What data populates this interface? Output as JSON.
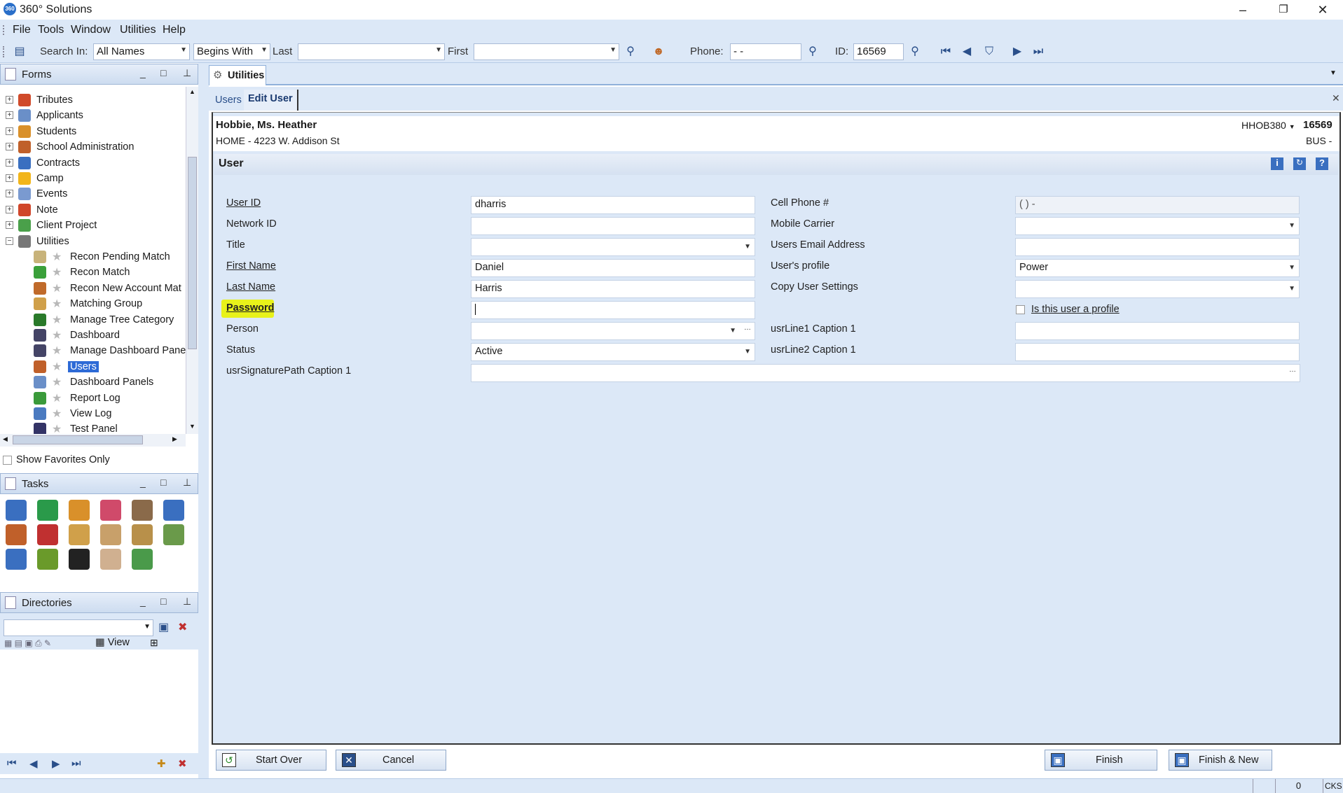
{
  "app": {
    "title": "360° Solutions",
    "logo_text": "360"
  },
  "window_controls": {
    "minimize": "–",
    "restore": "❐",
    "close": "✕"
  },
  "menu": [
    "File",
    "Tools",
    "Window",
    "Utilities",
    "Help"
  ],
  "toolbar": {
    "search_in_label": "Search In:",
    "search_in_value": "All Names",
    "match_value": "Begins With",
    "last_label": "Last",
    "last_value": "",
    "first_label": "First",
    "first_value": "",
    "phone_label": "Phone:",
    "phone_value": "-  -",
    "id_label": "ID:",
    "id_value": "16569"
  },
  "forms_pane": {
    "title": "Forms",
    "tree": [
      {
        "label": "Tributes",
        "level": 0,
        "color": "#d04a2a"
      },
      {
        "label": "Applicants",
        "level": 0,
        "color": "#6a8fc8"
      },
      {
        "label": "Students",
        "level": 0,
        "color": "#d9902a"
      },
      {
        "label": "School Administration",
        "level": 0,
        "color": "#c0602a"
      },
      {
        "label": "Contracts",
        "level": 0,
        "color": "#3a6fc0"
      },
      {
        "label": "Camp",
        "level": 0,
        "color": "#f2b51a"
      },
      {
        "label": "Events",
        "level": 0,
        "color": "#7a9ad0"
      },
      {
        "label": "Note",
        "level": 0,
        "color": "#d0462a"
      },
      {
        "label": "Client Project",
        "level": 0,
        "color": "#4aa04a"
      },
      {
        "label": "Utilities",
        "level": 0,
        "color": "#777777",
        "expanded": true
      },
      {
        "label": "Recon Pending Match",
        "level": 1,
        "color": "#c8b37a"
      },
      {
        "label": "Recon Match",
        "level": 1,
        "color": "#3aa03a"
      },
      {
        "label": "Recon New Account Mat",
        "level": 1,
        "color": "#c06a2a"
      },
      {
        "label": "Matching Group",
        "level": 1,
        "color": "#d0a04a"
      },
      {
        "label": "Manage Tree Category",
        "level": 1,
        "color": "#2a7a2a"
      },
      {
        "label": "Dashboard",
        "level": 1,
        "color": "#444466"
      },
      {
        "label": "Manage Dashboard Pane",
        "level": 1,
        "color": "#444466"
      },
      {
        "label": "Users",
        "level": 1,
        "color": "#c0602a",
        "selected": true
      },
      {
        "label": "Dashboard Panels",
        "level": 1,
        "color": "#6a8fc8"
      },
      {
        "label": "Report Log",
        "level": 1,
        "color": "#3a9a3a"
      },
      {
        "label": "View Log",
        "level": 1,
        "color": "#4a7ac0"
      },
      {
        "label": "Test Panel",
        "level": 1,
        "color": "#333366"
      }
    ],
    "show_favorites_label": "Show Favorites Only"
  },
  "tasks_pane": {
    "title": "Tasks",
    "icons": [
      "add-person-icon",
      "download-icon",
      "people-icon",
      "heart-icon",
      "school-icon",
      "calendar-icon",
      "building-icon",
      "building-red-icon",
      "group-icon",
      "box-icon",
      "box-person-icon",
      "box-open-icon",
      "phonebook-icon",
      "pencil-icon",
      "graduation-cap-icon",
      "bed-icon",
      "add-document-icon"
    ]
  },
  "directories_pane": {
    "title": "Directories",
    "view_label": "View"
  },
  "document_tab": {
    "label": "Utilities"
  },
  "subtabs": [
    "Users",
    "Edit User"
  ],
  "header": {
    "name": "Hobbie,   Ms. Heather",
    "address": "HOME  - 4223 W. Addison St",
    "code": "HHOB380",
    "id": "16569",
    "bus": "BUS  -"
  },
  "section_title": "User",
  "form": {
    "user_id_label": "User ID",
    "user_id_value": "dharris",
    "network_id_label": "Network ID",
    "network_id_value": "",
    "title_label": "Title",
    "title_value": "",
    "first_name_label": "First Name",
    "first_name_value": "Daniel",
    "last_name_label": "Last Name",
    "last_name_value": "Harris",
    "password_label": "Password",
    "password_value": "",
    "person_label": "Person",
    "person_value": "",
    "status_label": "Status",
    "status_value": "Active",
    "signature_label": "usrSignaturePath Caption 1",
    "signature_value": "",
    "cell_label": "Cell Phone #",
    "cell_value": "(    )     -",
    "carrier_label": "Mobile Carrier",
    "carrier_value": "",
    "email_label": "Users Email Address",
    "email_value": "",
    "profile_label": "User's profile",
    "profile_value": "Power",
    "copy_label": "Copy User Settings",
    "copy_value": "",
    "is_profile_label": "Is this user a profile",
    "line1_label": "usrLine1 Caption 1",
    "line1_value": "",
    "line2_label": "usrLine2 Caption 1",
    "line2_value": ""
  },
  "buttons": {
    "start_over": "Start Over",
    "cancel": "Cancel",
    "finish": "Finish",
    "finish_new": "Finish & New"
  },
  "status": {
    "count": "0",
    "caps": "CKS"
  }
}
